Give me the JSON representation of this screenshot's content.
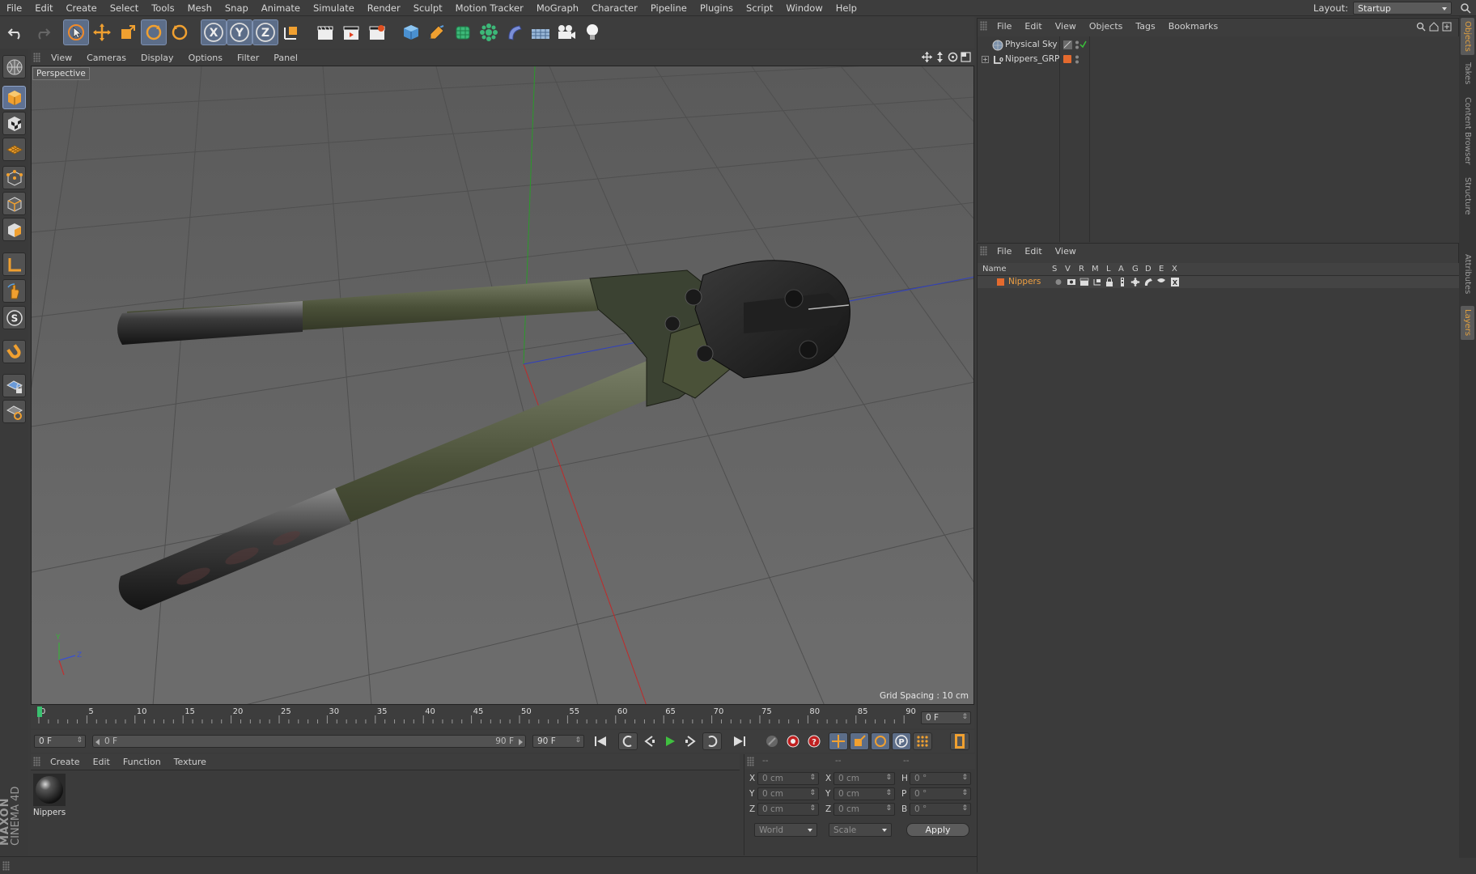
{
  "menu": {
    "items": [
      "File",
      "Edit",
      "Create",
      "Select",
      "Tools",
      "Mesh",
      "Snap",
      "Animate",
      "Simulate",
      "Render",
      "Sculpt",
      "Motion Tracker",
      "MoGraph",
      "Character",
      "Pipeline",
      "Plugins",
      "Script",
      "Window",
      "Help"
    ],
    "layout_label": "Layout:",
    "layout_value": "Startup"
  },
  "viewport": {
    "menu": [
      "View",
      "Cameras",
      "Display",
      "Options",
      "Filter",
      "Panel"
    ],
    "camera_label": "Perspective",
    "grid_spacing": "Grid Spacing : 10 cm"
  },
  "timeline": {
    "ticks": [
      "0",
      "5",
      "10",
      "15",
      "20",
      "25",
      "30",
      "35",
      "40",
      "45",
      "50",
      "55",
      "60",
      "65",
      "70",
      "75",
      "80",
      "85",
      "90"
    ],
    "current_frame_field": "0 F",
    "start_field": "0 F",
    "range_start": "0 F",
    "range_end": "90 F",
    "end_field": "90 F"
  },
  "material_manager": {
    "menu": [
      "Create",
      "Edit",
      "Function",
      "Texture"
    ],
    "materials": [
      {
        "name": "Nippers"
      }
    ]
  },
  "coordinates": {
    "header": [
      "--",
      "--",
      "--"
    ],
    "rows": [
      {
        "a": "X",
        "v1": "0 cm",
        "b": "X",
        "v2": "0 cm",
        "c": "H",
        "v3": "0 °"
      },
      {
        "a": "Y",
        "v1": "0 cm",
        "b": "Y",
        "v2": "0 cm",
        "c": "P",
        "v3": "0 °"
      },
      {
        "a": "Z",
        "v1": "0 cm",
        "b": "Z",
        "v2": "0 cm",
        "c": "B",
        "v3": "0 °"
      }
    ],
    "mode1": "World",
    "mode2": "Scale",
    "apply_label": "Apply"
  },
  "object_manager": {
    "menu": [
      "File",
      "Edit",
      "View",
      "Objects",
      "Tags",
      "Bookmarks"
    ],
    "objects": [
      {
        "name": "Physical Sky",
        "icon": "sky-icon"
      },
      {
        "name": "Nippers_GRP",
        "icon": "null-icon"
      }
    ]
  },
  "layer_manager": {
    "menu": [
      "File",
      "Edit",
      "View"
    ],
    "columns": [
      "Name",
      "S",
      "V",
      "R",
      "M",
      "L",
      "A",
      "G",
      "D",
      "E",
      "X"
    ],
    "layers": [
      {
        "name": "Nippers",
        "color": "#e46a2e"
      }
    ]
  },
  "side_tabs": [
    "Objects",
    "Takes",
    "Content Browser",
    "Structure",
    "Attributes",
    "Layers"
  ],
  "logo": {
    "line1": "MAXON",
    "line2": "CINEMA 4D"
  },
  "colors": {
    "accent": "#f0a042",
    "selection_blue": "#5c6d88",
    "layer_orange": "#e46a2e"
  }
}
